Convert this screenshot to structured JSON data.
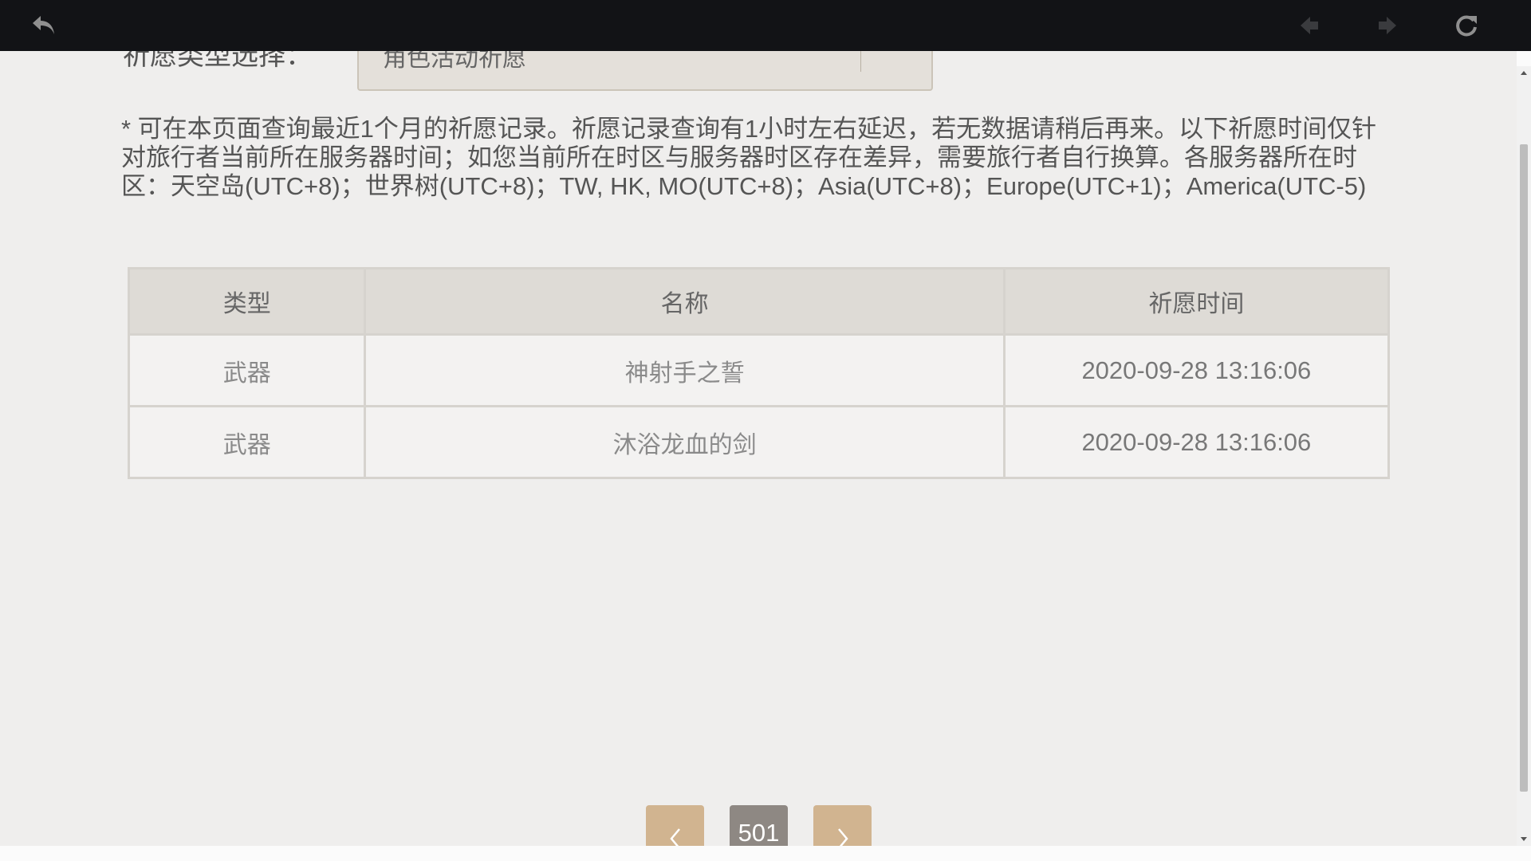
{
  "toolbar": {
    "back_icon": "back-arrow-icon",
    "prev_icon": "nav-prev-icon",
    "next_icon": "nav-next-icon",
    "reload_icon": "reload-icon"
  },
  "filter": {
    "label": "祈愿类型选择：",
    "selected": "角色活动祈愿"
  },
  "notice": "* 可在本页面查询最近1个月的祈愿记录。祈愿记录查询有1小时左右延迟，若无数据请稍后再来。以下祈愿时间仅针对旅行者当前所在服务器时间；如您当前所在时区与服务器时区存在差异，需要旅行者自行换算。各服务器所在时区：天空岛(UTC+8)；世界树(UTC+8)；TW, HK, MO(UTC+8)；Asia(UTC+8)；Europe(UTC+1)；America(UTC-5)",
  "table": {
    "headers": [
      "类型",
      "名称",
      "祈愿时间"
    ],
    "rows": [
      {
        "type": "武器",
        "name": "神射手之誓",
        "time": "2020-09-28 13:16:06"
      },
      {
        "type": "武器",
        "name": "沐浴龙血的剑",
        "time": "2020-09-28 13:16:06"
      }
    ]
  },
  "pagination": {
    "current_page": "501",
    "prev_icon": "chevron-left-icon",
    "next_icon": "chevron-right-icon"
  },
  "colors": {
    "topbar": "#121316",
    "page_background": "#efeeed",
    "header_cell": "#dedbd6",
    "pager_button": "#d1b490",
    "current_page": "#8e8883"
  }
}
